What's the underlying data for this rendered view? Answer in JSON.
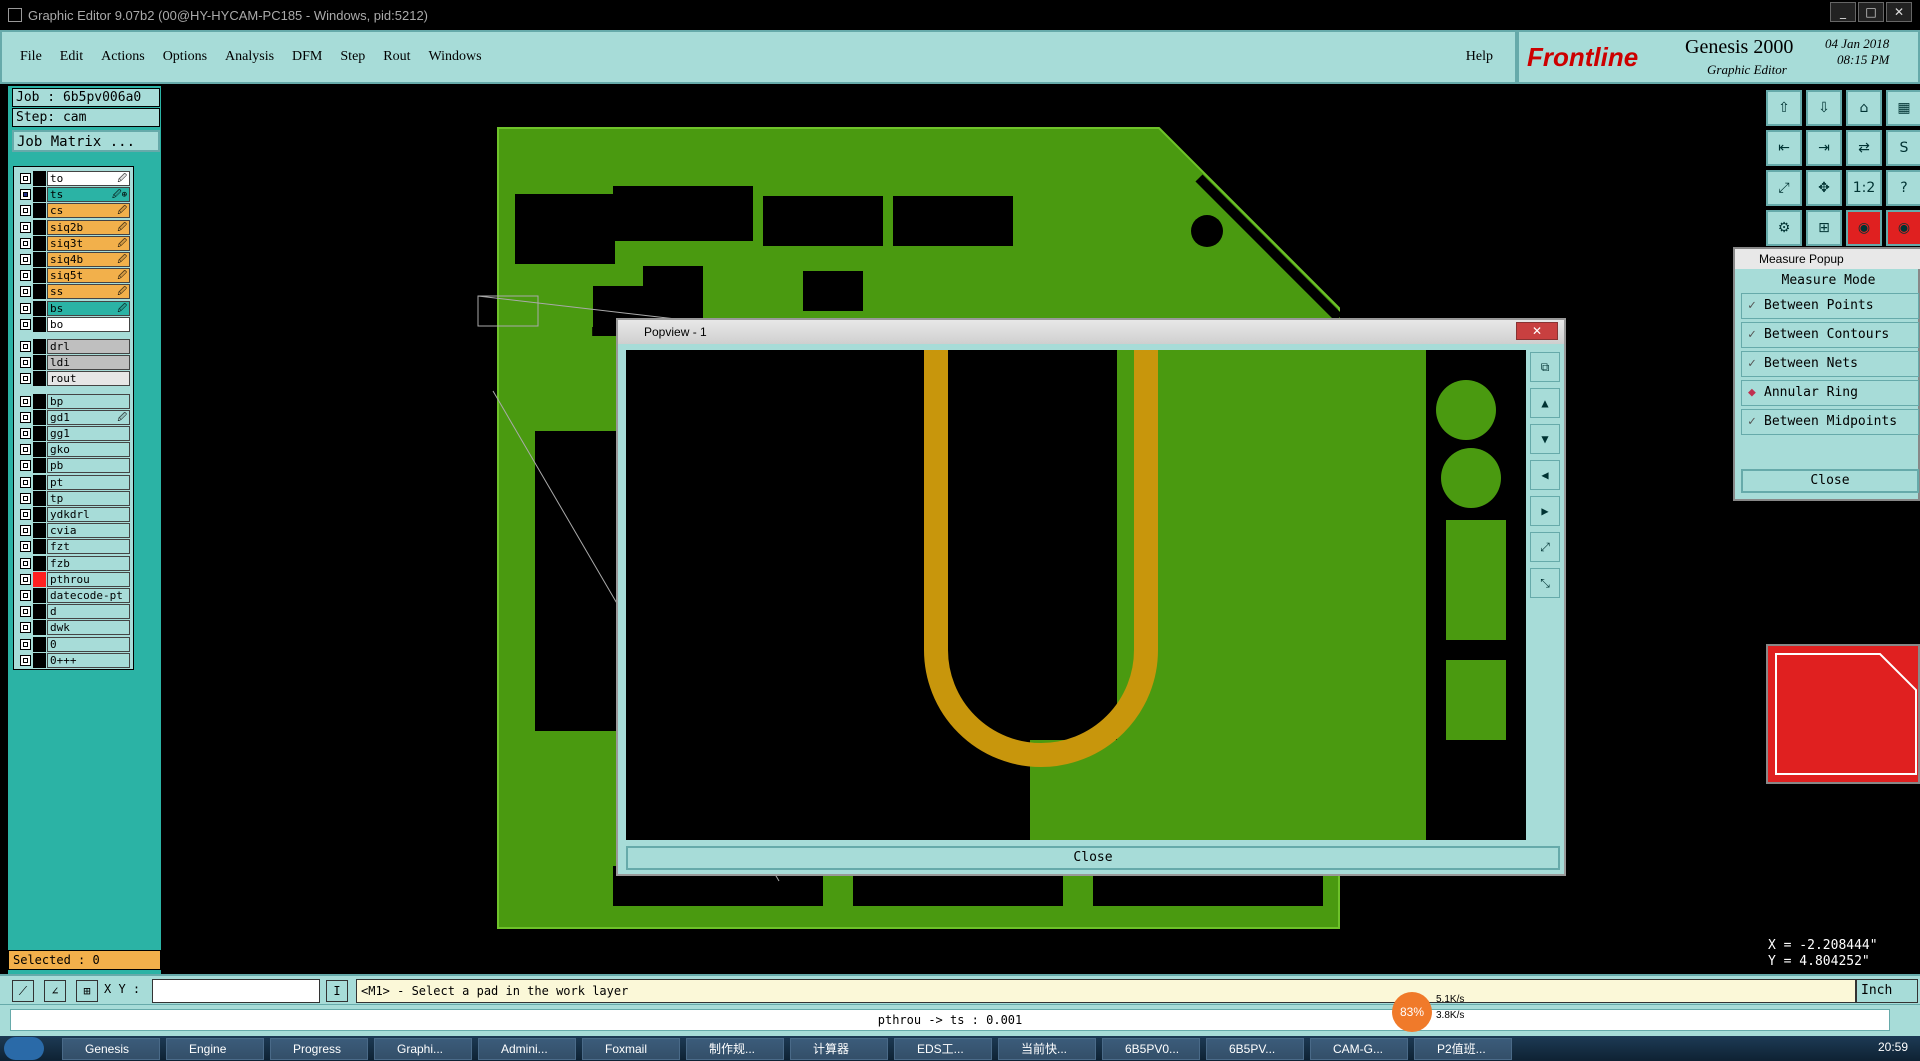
{
  "window": {
    "title": "Graphic Editor 9.07b2 (00@HY-HYCAM-PC185 - Windows, pid:5212)",
    "btn_min": "_",
    "btn_max": "□",
    "btn_close": "✕"
  },
  "menu": {
    "items": [
      "File",
      "Edit",
      "Actions",
      "Options",
      "Analysis",
      "DFM",
      "Step",
      "Rout",
      "Windows"
    ],
    "help": "Help"
  },
  "brand": {
    "company": "Frontline",
    "product": "Genesis 2000",
    "module": "Graphic Editor",
    "date": "04 Jan 2018",
    "time": "08:15 PM"
  },
  "job": {
    "job_line": "Job : 6b5pv006a0",
    "step_line": "Step: cam",
    "matrix_button": "Job Matrix ..."
  },
  "layers": [
    {
      "name": "to",
      "color": "#ffffff",
      "mark": "🖉"
    },
    {
      "name": "ts",
      "color": "#2bb3a5",
      "mark": "🖉⊕",
      "active": true
    },
    {
      "name": "cs",
      "color": "#f2b04b",
      "mark": "🖉"
    },
    {
      "name": "siq2b",
      "color": "#f2b04b",
      "mark": "🖉"
    },
    {
      "name": "siq3t",
      "color": "#f2b04b",
      "mark": "🖉"
    },
    {
      "name": "siq4b",
      "color": "#f2b04b",
      "mark": "🖉"
    },
    {
      "name": "siq5t",
      "color": "#f2b04b",
      "mark": "🖉"
    },
    {
      "name": "ss",
      "color": "#f2b04b",
      "mark": "🖉"
    },
    {
      "name": "bs",
      "color": "#2bb3a5",
      "mark": "🖉"
    },
    {
      "name": "bo",
      "color": "#ffffff",
      "mark": ""
    },
    {
      "name": "drl",
      "color": "#bfbfbf",
      "mark": ""
    },
    {
      "name": "ldi",
      "color": "#bfbfbf",
      "mark": ""
    },
    {
      "name": "rout",
      "color": "#e6e6e6",
      "mark": ""
    },
    {
      "name": "bp",
      "color": "#a7dcd8",
      "mark": ""
    },
    {
      "name": "gd1",
      "color": "#a7dcd8",
      "mark": "🖉"
    },
    {
      "name": "gg1",
      "color": "#a7dcd8",
      "mark": ""
    },
    {
      "name": "gko",
      "color": "#a7dcd8",
      "mark": ""
    },
    {
      "name": "pb",
      "color": "#a7dcd8",
      "mark": ""
    },
    {
      "name": "pt",
      "color": "#a7dcd8",
      "mark": ""
    },
    {
      "name": "tp",
      "color": "#a7dcd8",
      "mark": ""
    },
    {
      "name": "ydkdrl",
      "color": "#a7dcd8",
      "mark": ""
    },
    {
      "name": "cvia",
      "color": "#a7dcd8",
      "mark": ""
    },
    {
      "name": "fzt",
      "color": "#a7dcd8",
      "mark": ""
    },
    {
      "name": "fzb",
      "color": "#a7dcd8",
      "mark": ""
    },
    {
      "name": "pthrou",
      "color": "#a7dcd8",
      "mark": "",
      "swatch": "#ff2020"
    },
    {
      "name": "datecode-pt",
      "color": "#a7dcd8",
      "mark": ""
    },
    {
      "name": "d",
      "color": "#a7dcd8",
      "mark": ""
    },
    {
      "name": "dwk",
      "color": "#a7dcd8",
      "mark": ""
    },
    {
      "name": "0",
      "color": "#a7dcd8",
      "mark": ""
    },
    {
      "name": "0+++",
      "color": "#a7dcd8",
      "mark": ""
    }
  ],
  "selected": "Selected : 0",
  "measure": {
    "title": "Measure Popup",
    "header": "Measure Mode",
    "options": [
      "Between Points",
      "Between Contours",
      "Between Nets",
      "Annular Ring",
      "Between Midpoints"
    ],
    "active_index": 3,
    "close": "Close"
  },
  "popview": {
    "title": "Popview - 1",
    "close": "Close"
  },
  "coords": {
    "x": "X = -2.208444\"",
    "y": "Y = 4.804252\""
  },
  "bottom": {
    "xy_label": "X Y :",
    "message": "<M1> - Select a pad in the work layer",
    "unit": "Inch"
  },
  "status": "pthrou -> ts : 0.001",
  "net": {
    "percent": "83%",
    "up": "5.1K/s",
    "down": "3.8K/s"
  },
  "taskbar": {
    "items": [
      "Genesis",
      "Engine",
      "Progress",
      "Graphi...",
      "Admini...",
      "Foxmail",
      "制作规...",
      "计算器",
      "EDS工...",
      "当前快...",
      "6B5PV0...",
      "6B5PV...",
      "CAM-G...",
      "P2值班..."
    ],
    "clock": "20:59"
  },
  "colors": {
    "board": "#4a9a10",
    "copper_trace": "#c8960c",
    "panel": "#a7dcd8",
    "frame": "#2bb3a5"
  }
}
